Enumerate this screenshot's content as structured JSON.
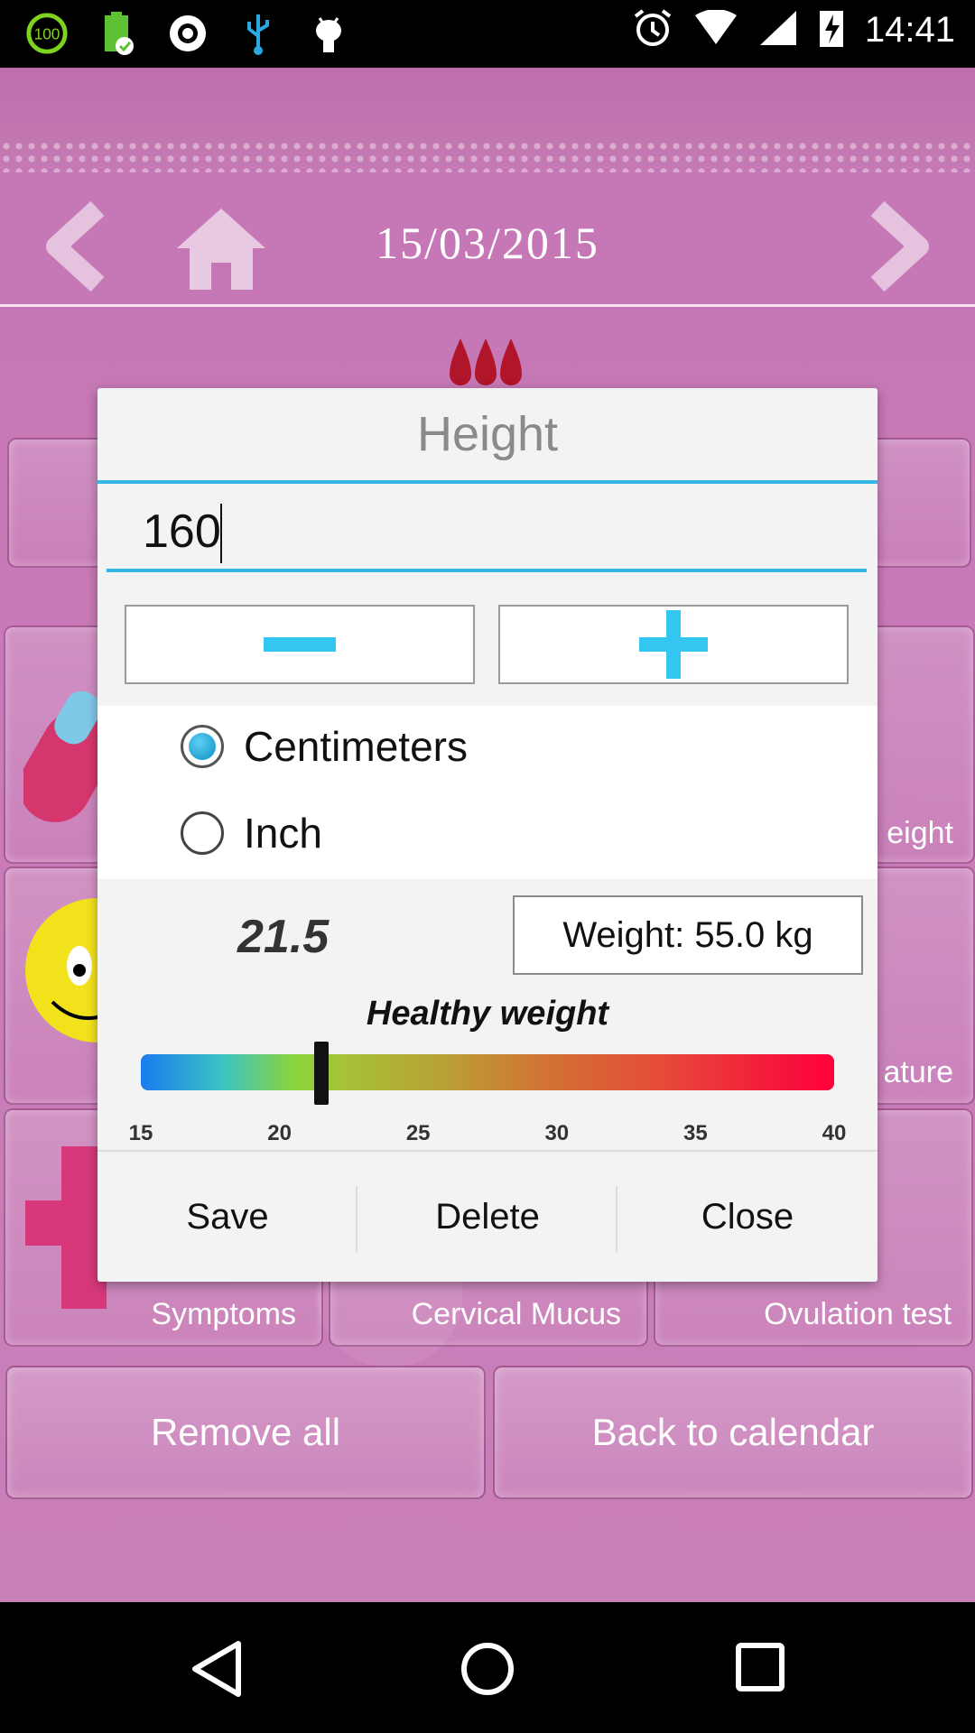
{
  "status_bar": {
    "time": "14:41",
    "left_icons": [
      "battery-percent-icon",
      "battery-charging-icon",
      "app-icon",
      "usb-icon",
      "android-debug-icon"
    ],
    "right_icons": [
      "alarm-icon",
      "wifi-icon",
      "signal-icon",
      "charging-icon"
    ],
    "battery_badge": "100"
  },
  "header": {
    "date": "15/03/2015",
    "prev_icon": "chevron-left-icon",
    "home_icon": "home-icon",
    "next_icon": "chevron-right-icon"
  },
  "background_tiles": {
    "partial_labels": {
      "weight": "eight",
      "temperature": "ature"
    },
    "bottom_row": [
      "Symptoms",
      "Cervical Mucus",
      "Ovulation test"
    ]
  },
  "footer_buttons": {
    "remove_all": "Remove all",
    "back_to_calendar": "Back to calendar"
  },
  "dialog": {
    "title": "Height",
    "height_value": "160",
    "minus_icon": "minus-icon",
    "plus_icon": "plus-icon",
    "units": [
      {
        "label": "Centimeters",
        "selected": true
      },
      {
        "label": "Inch",
        "selected": false
      }
    ],
    "bmi_value": "21.5",
    "weight_button": "Weight: 55.0 kg",
    "status": "Healthy weight",
    "scale": {
      "min": 15,
      "max": 40,
      "ticks": [
        "15",
        "20",
        "25",
        "30",
        "35",
        "40"
      ],
      "marker_value": 21.5,
      "colors": [
        "#1a7cf0",
        "#8bd43c",
        "#b9a034",
        "#e64b38",
        "#ff003c"
      ]
    },
    "actions": {
      "save": "Save",
      "delete": "Delete",
      "close": "Close"
    }
  },
  "system_nav": {
    "back_icon": "back-triangle-icon",
    "home_icon": "home-circle-icon",
    "recents_icon": "recents-square-icon"
  },
  "colors": {
    "accent": "#33b5e5",
    "app_pink": "#c677b6"
  }
}
